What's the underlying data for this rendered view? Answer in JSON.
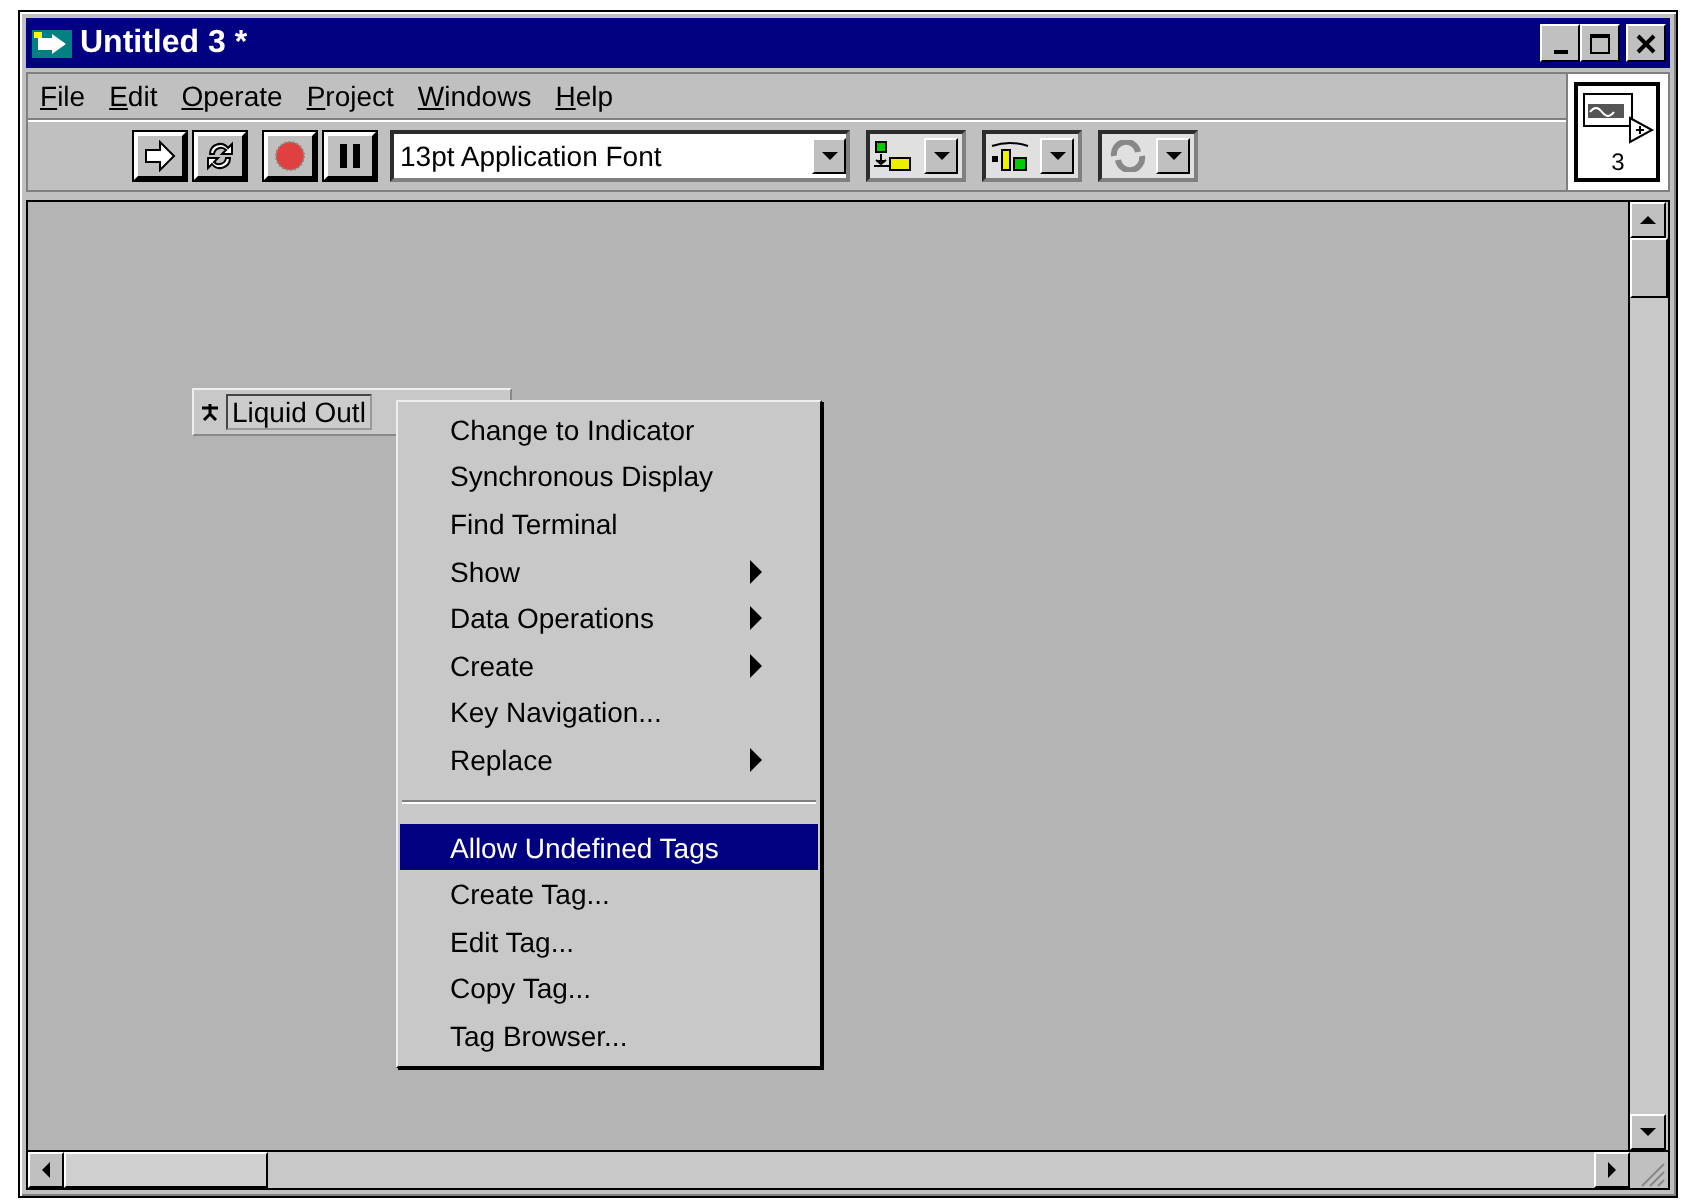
{
  "window": {
    "title": "Untitled 3 *"
  },
  "menu_bar": [
    "File",
    "Edit",
    "Operate",
    "Project",
    "Windows",
    "Help"
  ],
  "toolbar": {
    "font": "13pt Application Font"
  },
  "connector_pane": {
    "label": "3"
  },
  "control": {
    "label": "Liquid Outl"
  },
  "context_menu": [
    {
      "kind": "item",
      "label": "Change to Indicator",
      "submenu": false,
      "selected": false
    },
    {
      "kind": "item",
      "label": "Synchronous Display",
      "submenu": false,
      "selected": false
    },
    {
      "kind": "item",
      "label": "Find Terminal",
      "submenu": false,
      "selected": false
    },
    {
      "kind": "item",
      "label": "Show",
      "submenu": true,
      "selected": false
    },
    {
      "kind": "item",
      "label": "Data Operations",
      "submenu": true,
      "selected": false
    },
    {
      "kind": "item",
      "label": "Create",
      "submenu": true,
      "selected": false
    },
    {
      "kind": "item",
      "label": "Key Navigation...",
      "submenu": false,
      "selected": false
    },
    {
      "kind": "item",
      "label": "Replace",
      "submenu": true,
      "selected": false
    },
    {
      "kind": "separator"
    },
    {
      "kind": "item",
      "label": "Allow Undefined Tags",
      "submenu": false,
      "selected": true
    },
    {
      "kind": "item",
      "label": "Create Tag...",
      "submenu": false,
      "selected": false
    },
    {
      "kind": "item",
      "label": "Edit Tag...",
      "submenu": false,
      "selected": false
    },
    {
      "kind": "item",
      "label": "Copy Tag...",
      "submenu": false,
      "selected": false
    },
    {
      "kind": "item",
      "label": "Tag Browser...",
      "submenu": false,
      "selected": false
    }
  ]
}
